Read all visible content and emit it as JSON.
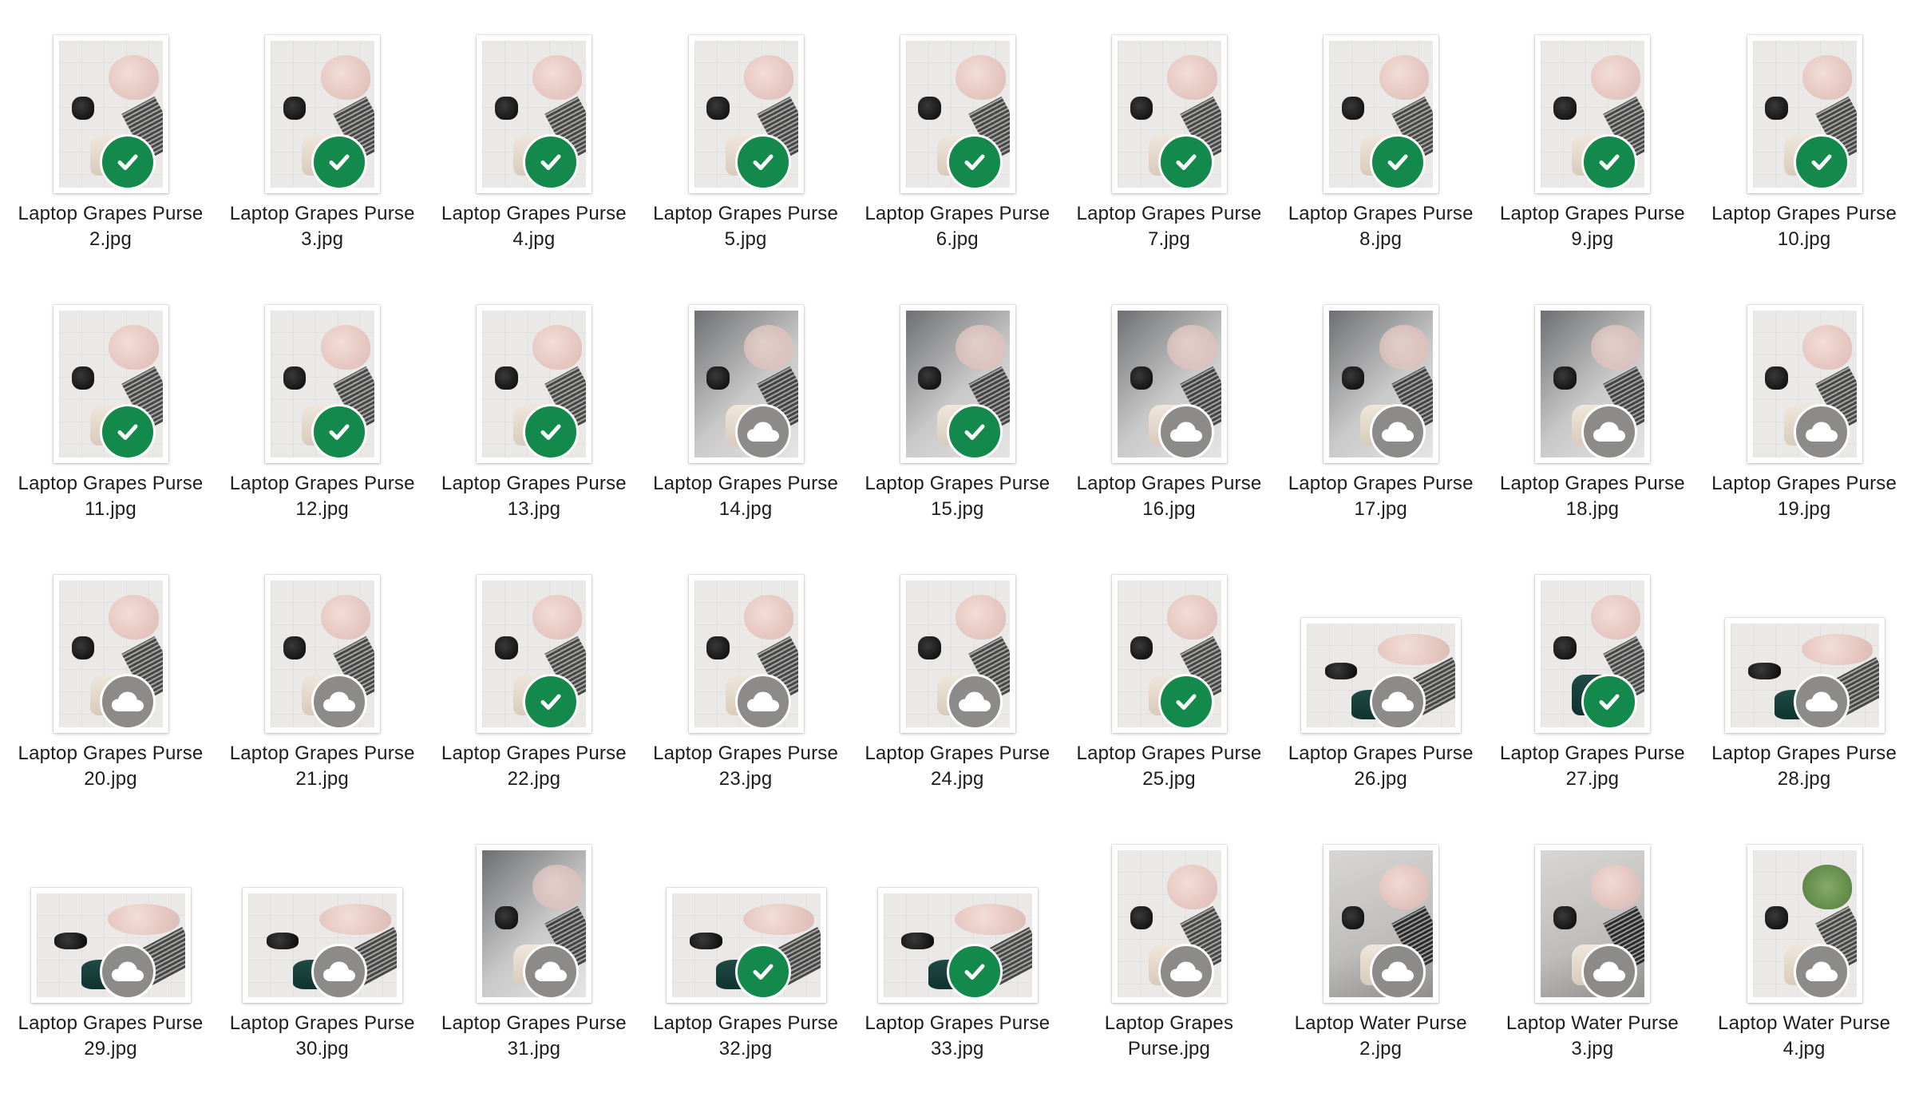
{
  "files": [
    {
      "name": [
        "Laptop Grapes Purse",
        "2.jpg"
      ],
      "status": "synced",
      "orientation": "portrait",
      "tone": "light"
    },
    {
      "name": [
        "Laptop Grapes Purse",
        "3.jpg"
      ],
      "status": "synced",
      "orientation": "portrait",
      "tone": "light"
    },
    {
      "name": [
        "Laptop Grapes Purse",
        "4.jpg"
      ],
      "status": "synced",
      "orientation": "portrait",
      "tone": "light"
    },
    {
      "name": [
        "Laptop Grapes Purse",
        "5.jpg"
      ],
      "status": "synced",
      "orientation": "portrait",
      "tone": "light"
    },
    {
      "name": [
        "Laptop Grapes Purse",
        "6.jpg"
      ],
      "status": "synced",
      "orientation": "portrait",
      "tone": "light"
    },
    {
      "name": [
        "Laptop Grapes Purse",
        "7.jpg"
      ],
      "status": "synced",
      "orientation": "portrait",
      "tone": "light"
    },
    {
      "name": [
        "Laptop Grapes Purse",
        "8.jpg"
      ],
      "status": "synced",
      "orientation": "portrait",
      "tone": "light"
    },
    {
      "name": [
        "Laptop Grapes Purse",
        "9.jpg"
      ],
      "status": "synced",
      "orientation": "portrait",
      "tone": "light"
    },
    {
      "name": [
        "Laptop Grapes Purse",
        "10.jpg"
      ],
      "status": "synced",
      "orientation": "portrait",
      "tone": "light"
    },
    {
      "name": [
        "Laptop Grapes Purse",
        "11.jpg"
      ],
      "status": "synced",
      "orientation": "portrait",
      "tone": "light"
    },
    {
      "name": [
        "Laptop Grapes Purse",
        "12.jpg"
      ],
      "status": "synced",
      "orientation": "portrait",
      "tone": "light"
    },
    {
      "name": [
        "Laptop Grapes Purse",
        "13.jpg"
      ],
      "status": "synced",
      "orientation": "portrait",
      "tone": "light"
    },
    {
      "name": [
        "Laptop Grapes Purse",
        "14.jpg"
      ],
      "status": "cloud",
      "orientation": "portrait",
      "tone": "dark"
    },
    {
      "name": [
        "Laptop Grapes Purse",
        "15.jpg"
      ],
      "status": "synced",
      "orientation": "portrait",
      "tone": "dark"
    },
    {
      "name": [
        "Laptop Grapes Purse",
        "16.jpg"
      ],
      "status": "cloud",
      "orientation": "portrait",
      "tone": "dark"
    },
    {
      "name": [
        "Laptop Grapes Purse",
        "17.jpg"
      ],
      "status": "cloud",
      "orientation": "portrait",
      "tone": "dark"
    },
    {
      "name": [
        "Laptop Grapes Purse",
        "18.jpg"
      ],
      "status": "cloud",
      "orientation": "portrait",
      "tone": "dark"
    },
    {
      "name": [
        "Laptop Grapes Purse",
        "19.jpg"
      ],
      "status": "cloud",
      "orientation": "portrait",
      "tone": "light"
    },
    {
      "name": [
        "Laptop Grapes Purse",
        "20.jpg"
      ],
      "status": "cloud",
      "orientation": "portrait",
      "tone": "light"
    },
    {
      "name": [
        "Laptop Grapes Purse",
        "21.jpg"
      ],
      "status": "cloud",
      "orientation": "portrait",
      "tone": "light"
    },
    {
      "name": [
        "Laptop Grapes Purse",
        "22.jpg"
      ],
      "status": "synced",
      "orientation": "portrait",
      "tone": "light"
    },
    {
      "name": [
        "Laptop Grapes Purse",
        "23.jpg"
      ],
      "status": "cloud",
      "orientation": "portrait",
      "tone": "light"
    },
    {
      "name": [
        "Laptop Grapes Purse",
        "24.jpg"
      ],
      "status": "cloud",
      "orientation": "portrait",
      "tone": "light"
    },
    {
      "name": [
        "Laptop Grapes Purse",
        "25.jpg"
      ],
      "status": "synced",
      "orientation": "portrait",
      "tone": "light"
    },
    {
      "name": [
        "Laptop Grapes Purse",
        "26.jpg"
      ],
      "status": "cloud",
      "orientation": "landscape",
      "tone": "green"
    },
    {
      "name": [
        "Laptop Grapes Purse",
        "27.jpg"
      ],
      "status": "synced",
      "orientation": "portrait",
      "tone": "green"
    },
    {
      "name": [
        "Laptop Grapes Purse",
        "28.jpg"
      ],
      "status": "cloud",
      "orientation": "landscape",
      "tone": "green"
    },
    {
      "name": [
        "Laptop Grapes Purse",
        "29.jpg"
      ],
      "status": "cloud",
      "orientation": "landscape",
      "tone": "green"
    },
    {
      "name": [
        "Laptop Grapes Purse",
        "30.jpg"
      ],
      "status": "cloud",
      "orientation": "landscape",
      "tone": "green"
    },
    {
      "name": [
        "Laptop Grapes Purse",
        "31.jpg"
      ],
      "status": "cloud",
      "orientation": "portrait",
      "tone": "dark"
    },
    {
      "name": [
        "Laptop Grapes Purse",
        "32.jpg"
      ],
      "status": "synced",
      "orientation": "landscape",
      "tone": "green"
    },
    {
      "name": [
        "Laptop Grapes Purse",
        "33.jpg"
      ],
      "status": "synced",
      "orientation": "landscape",
      "tone": "green"
    },
    {
      "name": [
        "Laptop Grapes",
        "Purse.jpg"
      ],
      "status": "cloud",
      "orientation": "portrait",
      "tone": "light"
    },
    {
      "name": [
        "Laptop Water Purse",
        "2.jpg"
      ],
      "status": "cloud",
      "orientation": "portrait",
      "tone": "water"
    },
    {
      "name": [
        "Laptop Water Purse",
        "3.jpg"
      ],
      "status": "cloud",
      "orientation": "portrait",
      "tone": "water"
    },
    {
      "name": [
        "Laptop Water Purse",
        "4.jpg"
      ],
      "status": "cloud",
      "orientation": "portrait",
      "tone": "plant"
    }
  ],
  "colors": {
    "synced_badge": "#138a4b",
    "cloud_badge": "#8d8b89",
    "label_text": "#1d1d1f",
    "background": "#ffffff"
  },
  "icons": {
    "synced": "checkmark-icon",
    "cloud": "cloud-icon"
  }
}
